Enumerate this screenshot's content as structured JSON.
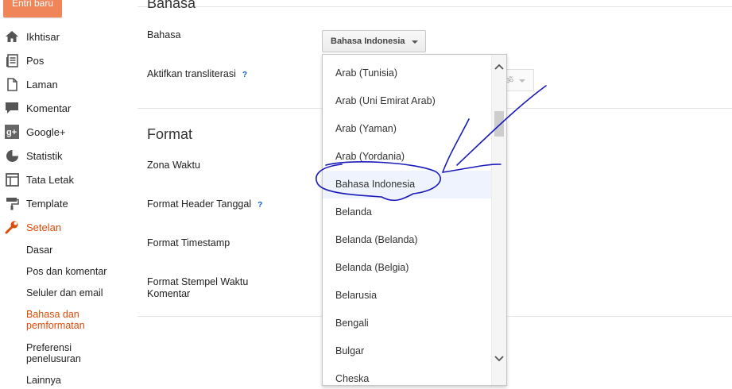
{
  "sidebar": {
    "new_post_label": "Entri baru",
    "items": [
      {
        "label": "Ikhtisar",
        "icon": "home-icon"
      },
      {
        "label": "Pos",
        "icon": "posts-icon"
      },
      {
        "label": "Laman",
        "icon": "pages-icon"
      },
      {
        "label": "Komentar",
        "icon": "comment-icon"
      },
      {
        "label": "Google+",
        "icon": "google-plus-icon"
      },
      {
        "label": "Statistik",
        "icon": "stats-icon"
      },
      {
        "label": "Tata Letak",
        "icon": "layout-icon"
      },
      {
        "label": "Template",
        "icon": "template-icon"
      },
      {
        "label": "Setelan",
        "icon": "wrench-icon",
        "active": true
      }
    ],
    "sub_items": [
      {
        "label": "Dasar"
      },
      {
        "label": "Pos dan komentar"
      },
      {
        "label": "Seluler dan email"
      },
      {
        "label": "Bahasa dan pemformatan",
        "active": true
      },
      {
        "label": "Preferensi penelusuran"
      },
      {
        "label": "Lainnya"
      }
    ]
  },
  "main": {
    "section_bahasa_title": "Bahasa",
    "bahasa_label": "Bahasa",
    "bahasa_selected": "Bahasa Indonesia",
    "translit_label": "Aktifkan transliterasi",
    "help_glyph": "?",
    "section_format_title": "Format",
    "zona_waktu_label": "Zona Waktu",
    "format_header_label": "Format Header Tanggal",
    "format_timestamp_label": "Format Timestamp",
    "format_stempel_label": "Format Stempel Waktu Komentar"
  },
  "dropdown": {
    "options": [
      "Arab (Tunisia)",
      "Arab (Uni Emirat Arab)",
      "Arab (Yaman)",
      "Arab (Yordania)",
      "Bahasa Indonesia",
      "Belanda",
      "Belanda (Belanda)",
      "Belanda (Belgia)",
      "Belarusia",
      "Bengali",
      "Bulgar",
      "Cheska"
    ],
    "selected": "Bahasa Indonesia"
  },
  "colors": {
    "accent": "#dd4b09",
    "button_orange": "#f0855a",
    "selected_bg": "#eef3fd",
    "annotation_ink": "#1a1ab8"
  }
}
